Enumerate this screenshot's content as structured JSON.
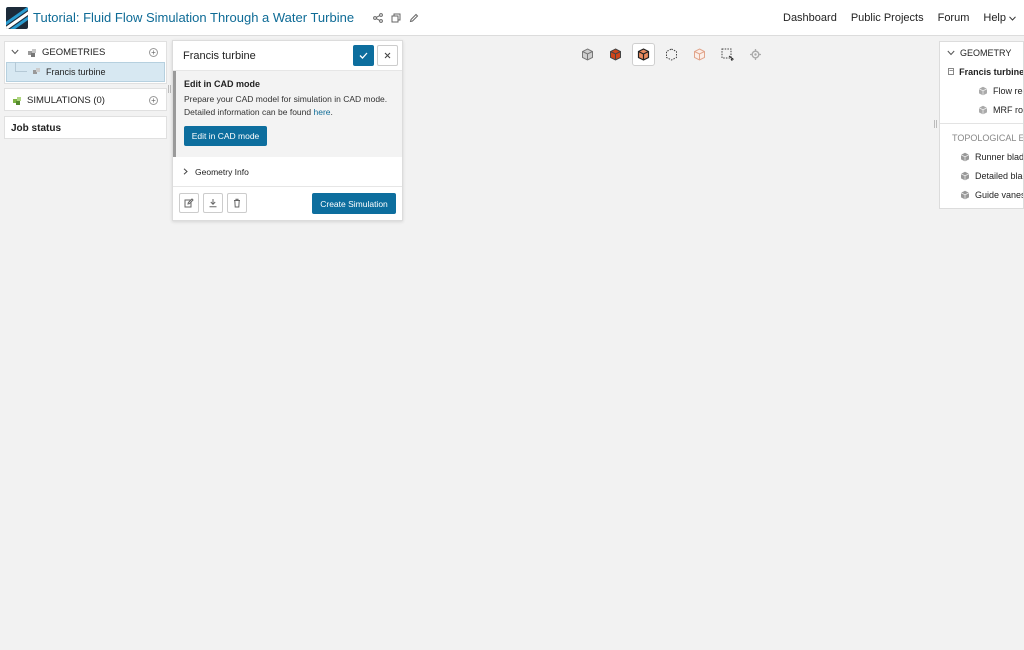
{
  "header": {
    "project_title": "Tutorial: Fluid Flow Simulation Through a Water Turbine",
    "nav": {
      "dashboard": "Dashboard",
      "public_projects": "Public Projects",
      "forum": "Forum",
      "help": "Help"
    }
  },
  "left_tree": {
    "geometries_label": "GEOMETRIES",
    "geometry_item": "Francis turbine",
    "simulations_label": "SIMULATIONS (0)",
    "job_status_label": "Job status"
  },
  "panel": {
    "title": "Francis turbine",
    "cad_title": "Edit in CAD mode",
    "cad_text": "Prepare your CAD model for simulation in CAD mode. Detailed information can be found ",
    "cad_link": "here",
    "cad_text_end": ".",
    "cad_button": "Edit in CAD mode",
    "geometry_info": "Geometry Info",
    "create_simulation": "Create Simulation"
  },
  "right_tree": {
    "geometry_label": "GEOMETRY",
    "root_item": "Francis turbine",
    "children": [
      "Flow reg",
      "MRF rota"
    ],
    "topological_label": "TOPOLOGICAL E",
    "topo_items": [
      "Runner blade",
      "Detailed blac",
      "Guide vanes"
    ]
  },
  "colors": {
    "accent": "#0d6e9e",
    "link": "#0e6b96",
    "selected_bg": "#d7e8f2",
    "canvas_bg": "#f2f2f2"
  },
  "icons": [
    "share-icon",
    "copy-icon",
    "pencil-icon",
    "check-icon",
    "close-icon",
    "chevron-right-icon",
    "edit-icon",
    "download-icon",
    "trash-icon",
    "cube-icon"
  ]
}
